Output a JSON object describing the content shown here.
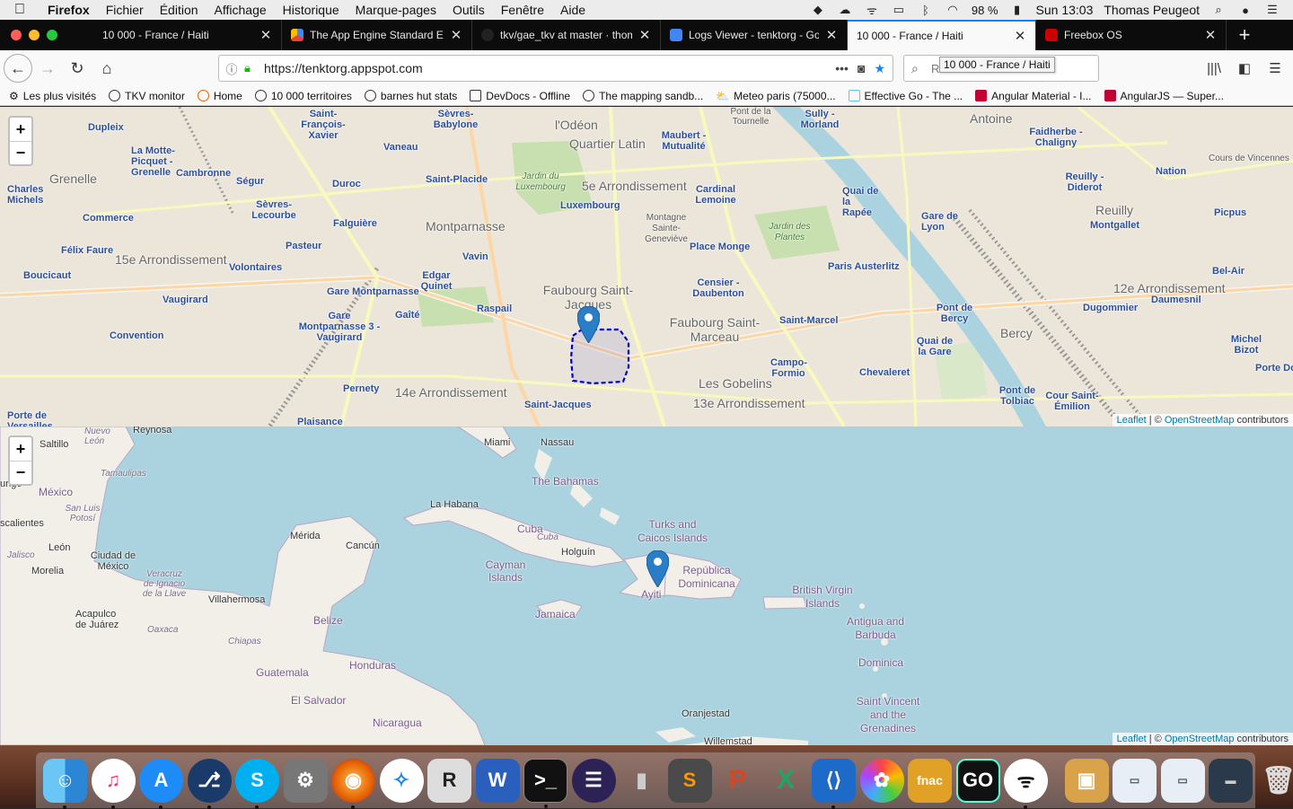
{
  "menubar": {
    "app": "Firefox",
    "items": [
      "Fichier",
      "Édition",
      "Affichage",
      "Historique",
      "Marque-pages",
      "Outils",
      "Fenêtre",
      "Aide"
    ],
    "battery": "98 %",
    "clock": "Sun 13:03",
    "user": "Thomas Peugeot"
  },
  "tabs": [
    {
      "title": "10 000 - France / Haiti",
      "active": false
    },
    {
      "title": "The App Engine Standard Env",
      "active": false
    },
    {
      "title": "tkv/gae_tkv at master · thom",
      "active": false
    },
    {
      "title": "Logs Viewer - tenktorg - Goo",
      "active": false
    },
    {
      "title": "10 000 - France / Haiti",
      "active": true
    },
    {
      "title": "Freebox OS",
      "active": false
    }
  ],
  "urlbar": {
    "url": "https://tenktorg.appspot.com"
  },
  "searchbar": {
    "placeholder": "Rechercher"
  },
  "tooltip": "10 000 - France / Haiti",
  "bookmarks": [
    "Les plus visités",
    "TKV monitor",
    "Home",
    "10 000 territoires",
    "barnes hut stats",
    "DevDocs - Offline",
    "The mapping sandb...",
    "Meteo paris (75000...",
    "Effective Go - The ...",
    "Angular Material - I...",
    "AngularJS — Super..."
  ],
  "map_paris": {
    "zoom_in": "+",
    "zoom_out": "−",
    "attribution_leaflet": "Leaflet",
    "attribution_sep": " | © ",
    "attribution_osm": "OpenStreetMap",
    "attribution_tail": " contributors",
    "labels": {
      "grenelle": "Grenelle",
      "arr15": "15e Arrondissement",
      "montparnasse": "Montparnasse",
      "quartier_latin": "Quartier Latin",
      "arr5": "5e Arrondissement",
      "odeon": "l'Odéon",
      "faubourg_sj": "Faubourg Saint-Jacques",
      "faubourg_sm": "Faubourg Saint-Marceau",
      "arr14": "14e Arrondissement",
      "gobelins": "Les Gobelins",
      "arr13": "13e Arrondissement",
      "arr12": "12e Arrondissement",
      "reuilly": "Reuilly",
      "bercy": "Bercy",
      "antoine": "Antoine",
      "dupleix": "Dupleix",
      "la_motte": "La Motte-Picquet - Grenelle",
      "cambronne": "Cambronne",
      "segur": "Ségur",
      "duroc": "Duroc",
      "vaneau": "Vaneau",
      "sevres_babylone": "Sèvres-Babylone",
      "saint_placide": "Saint-Placide",
      "sevres_lecourbe": "Sèvres-Lecourbe",
      "falguiere": "Falguière",
      "commerce": "Commerce",
      "charles_michels": "Charles Michels",
      "felix_faure": "Félix Faure",
      "pasteur": "Pasteur",
      "volontaires": "Volontaires",
      "boucicaut": "Boucicaut",
      "vavin": "Vavin",
      "edgar_quinet": "Edgar Quinet",
      "gare_montparnasse": "Gare Montparnasse",
      "gaite": "Gaîté",
      "raspail": "Raspail",
      "vaugirard": "Vaugirard",
      "convention": "Convention",
      "pernety": "Pernety",
      "plaisance": "Plaisance",
      "saint_jacques": "Saint-Jacques",
      "luxembourg": "Luxembourg",
      "cardinal_lemoine": "Cardinal Lemoine",
      "place_monge": "Place Monge",
      "censier": "Censier - Daubenton",
      "saint_marcel": "Saint-Marcel",
      "campo_formio": "Campo-Formio",
      "chevaleret": "Chevaleret",
      "gare_de_lyon": "Gare de Lyon",
      "paris_austerlitz": "Paris Austerlitz",
      "quai_rapee": "Quai de la Rapée",
      "sully": "Sully - Morland",
      "maubert": "Maubert - Mutualité",
      "pont_bercy": "Pont de Bercy",
      "quai_gare": "Quai de la Gare",
      "pont_tolbiac": "Pont de Tolbiac",
      "cour_saint_emilion": "Cour Saint-Émilion",
      "dugommier": "Dugommier",
      "daumesnil": "Daumesnil",
      "michel_bizot": "Michel Bizot",
      "porte_doree": "Porte Do",
      "bel_air": "Bel-Air",
      "picpus": "Picpus",
      "nation": "Nation",
      "faidherbe": "Faidherbe - Chaligny",
      "reuilly_diderot": "Reuilly - Diderot",
      "montgallet": "Montgallet",
      "pantheon": "Montagne Sainte-Geneviève",
      "jardin_plantes": "Jardin des Plantes",
      "jardin_lux": "Jardin du Luxembourg",
      "saint_francois": "Saint-François-Xavier",
      "tournelle": "Pont de la Tournelle",
      "porte_versailles": "Porte de Versailles",
      "gare_mont_vaugirard": "Gare Montparnasse 3 - Vaugirard",
      "cours_vincennes": "Cours de Vincennes"
    }
  },
  "map_carib": {
    "zoom_in": "+",
    "zoom_out": "−",
    "attribution_leaflet": "Leaflet",
    "attribution_sep": " | © ",
    "attribution_osm": "OpenStreetMap",
    "attribution_tail": " contributors",
    "labels": {
      "reynosa": "Reynosa",
      "saltillo": "Saltillo",
      "nuevo_leon": "Nuevo León",
      "tamaulipas": "Tamaulipas",
      "mexico": "México",
      "san_luis": "San Luis Potosí",
      "escalientes": "scalientes",
      "leon": "León",
      "jalisco": "Jalisco",
      "morelia": "Morelia",
      "ciudad_mexico": "Ciudad de México",
      "veracruz": "Veracruz de Ignacio de la Llave",
      "acapulco": "Acapulco de Juárez",
      "oaxaca": "Oaxaca",
      "villahermosa": "Villahermosa",
      "chiapas": "Chiapas",
      "merida": "Mérida",
      "cancun": "Cancún",
      "belize": "Belize",
      "guatemala": "Guatemala",
      "honduras": "Honduras",
      "el_salvador": "El Salvador",
      "nicaragua": "Nicaragua",
      "miami": "Miami",
      "nassau": "Nassau",
      "bahamas": "The Bahamas",
      "la_habana": "La Habana",
      "cuba": "Cuba",
      "cuba2": "Cuba",
      "holguin": "Holguín",
      "cayman": "Cayman Islands",
      "jamaica": "Jamaica",
      "turks": "Turks and Caicos Islands",
      "rep_dom": "República Dominicana",
      "ayiti": "Ayiti",
      "bvi": "British Virgin Islands",
      "antigua": "Antigua and Barbuda",
      "dominica": "Dominica",
      "st_vincent": "Saint Vincent and the Grenadines",
      "oranjestad": "Oranjestad",
      "willemstad": "Willemstad",
      "ungo": "ungo"
    }
  },
  "dock": [
    "Finder",
    "iTunes",
    "App Store",
    "Sourcetree",
    "Skype",
    "System Preferences",
    "Firefox",
    "Safari",
    "Rhino",
    "Word",
    "Terminal",
    "Eclipse",
    "Pen",
    "Sublime Text",
    "PowerPoint",
    "Excel",
    "Visual Studio Code",
    "Photos",
    "Fnac",
    "GoLand",
    "Freebox",
    "Box",
    "Window",
    "Window 2",
    "Screen",
    "Trash"
  ],
  "colors": {
    "accent": "#0a84ff",
    "polygon": "#0000cc",
    "marker": "#2a7ec7",
    "sea": "#aad3df"
  }
}
